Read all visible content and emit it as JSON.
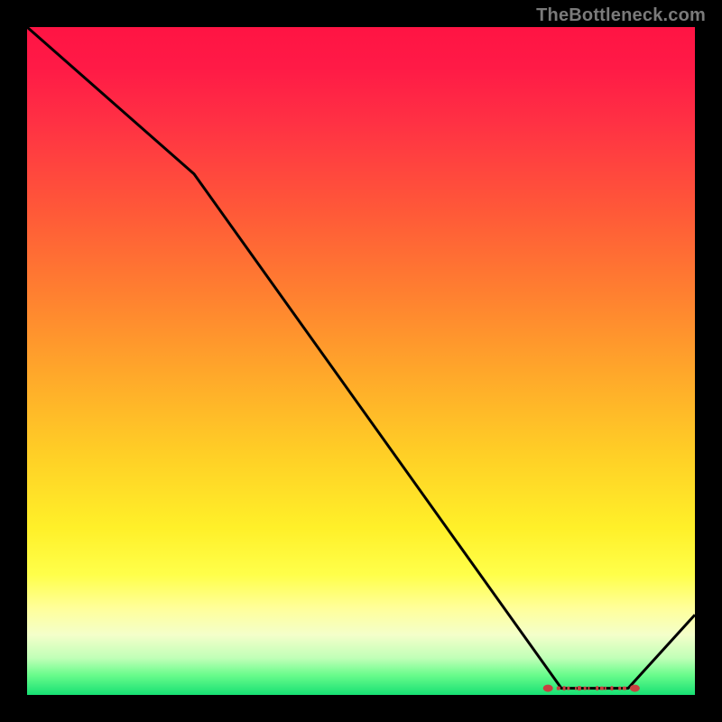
{
  "attribution": "TheBottleneck.com",
  "chart_data": {
    "type": "line",
    "title": "",
    "xlabel": "",
    "ylabel": "",
    "xlim": [
      0,
      100
    ],
    "ylim": [
      0,
      100
    ],
    "x": [
      0,
      25,
      80,
      90,
      100
    ],
    "values": [
      100,
      78,
      1,
      1,
      12
    ],
    "series_style": {
      "color": "#000000",
      "line_width": 3
    },
    "flat_region_annotation": {
      "x_start": 78,
      "x_end": 91,
      "y": 1,
      "marker_color": "#c84040",
      "has_scattered_text_glyphs": true
    },
    "background_gradient": {
      "orientation": "vertical",
      "stops": [
        {
          "pos": 0.0,
          "color": "#ff1444"
        },
        {
          "pos": 0.5,
          "color": "#ffb028"
        },
        {
          "pos": 0.82,
          "color": "#ffff4a"
        },
        {
          "pos": 1.0,
          "color": "#17e073"
        }
      ]
    }
  }
}
